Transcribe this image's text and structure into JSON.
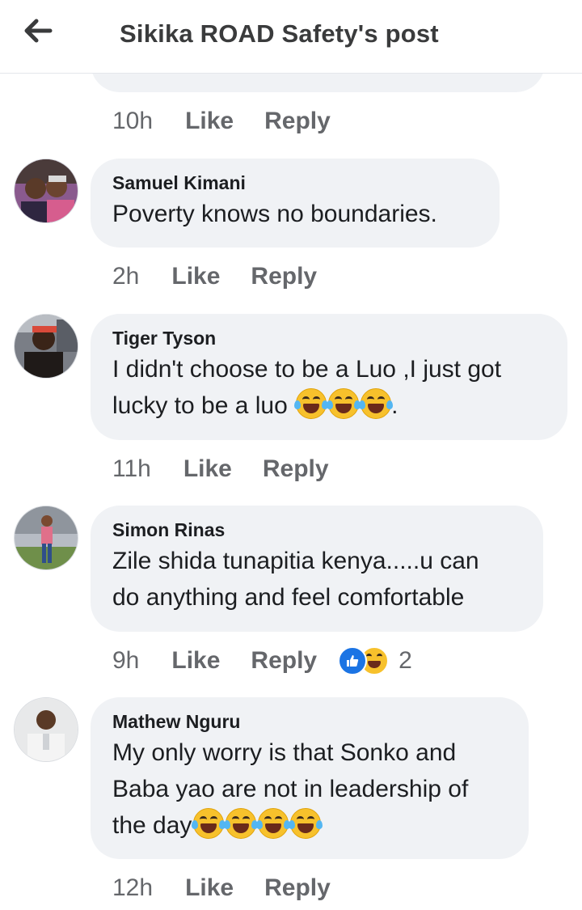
{
  "header": {
    "title": "Sikika ROAD Safety's post",
    "back_icon": "arrow-left-icon"
  },
  "previous_comment": {
    "meta": {
      "time": "10h",
      "like": "Like",
      "reply": "Reply"
    }
  },
  "comments": [
    {
      "author": "Samuel Kimani",
      "text": "Poverty knows no boundaries.",
      "emojis": [],
      "time": "2h",
      "like": "Like",
      "reply": "Reply"
    },
    {
      "author": "Tiger Tyson",
      "text_line1": "I didn't choose to be a Luo ,I just got",
      "text_line2": "lucky to be a luo",
      "emojis": [
        "rolling-on-floor-laughing",
        "rolling-on-floor-laughing",
        "face-with-tears-of-joy"
      ],
      "text_suffix": ".",
      "time": "11h",
      "like": "Like",
      "reply": "Reply"
    },
    {
      "author": "Simon Rinas",
      "text_line1": "Zile shida tunapitia kenya.....u can",
      "text_line2": "do anything and feel comfortable",
      "time": "9h",
      "like": "Like",
      "reply": "Reply",
      "reactions": {
        "types": [
          "like",
          "haha"
        ],
        "count": "2"
      }
    },
    {
      "author": "Mathew Nguru",
      "text_line1": "My only worry is that Sonko and",
      "text_line2": "Baba yao are not in leadership of",
      "text_line3": "the day",
      "emojis": [
        "face-with-tears-of-joy",
        "face-with-tears-of-joy",
        "face-with-tears-of-joy",
        "face-with-tears-of-joy"
      ],
      "time": "12h",
      "like": "Like",
      "reply": "Reply"
    }
  ],
  "colors": {
    "bubble": "#f0f2f5",
    "meta_text": "#65676b",
    "like_blue": "#1b74e4",
    "emoji_yellow": "#f7c12c"
  }
}
